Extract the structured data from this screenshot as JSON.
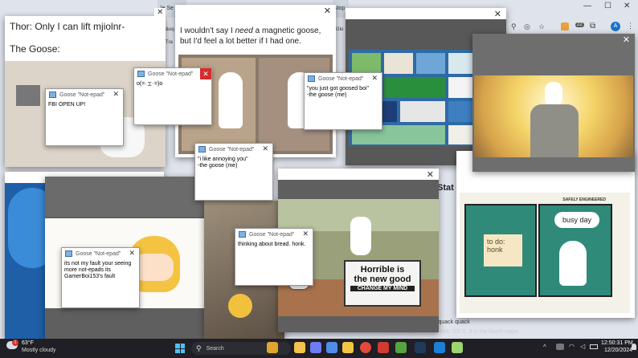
{
  "browser": {
    "tabs": [
      "le Se",
      "stop"
    ],
    "bookmarks": [
      "&oq",
      "Tra",
      "Glo"
    ],
    "profile_initial": "A",
    "ext_badge": "22"
  },
  "meme1": {
    "line1": "Thor: Only I can lift mjiolnr-",
    "line2": "The Goose:"
  },
  "meme2": {
    "text_before": "I wouldn't say I ",
    "text_em": "need",
    "text_after": " a magnetic goose, but I'd feel a lot better if I had one."
  },
  "meme_busy": {
    "header": "SAFELY ENGINEERED",
    "todo": "to do:\nhonk",
    "busy": "busy day"
  },
  "meme_change": {
    "line1": "Horrible is",
    "line2": "the new good",
    "line3": "CHANGE MY MIND"
  },
  "notepads": [
    {
      "title": "Goose \"Not-epad\"",
      "text": "FBI OPEN UP!"
    },
    {
      "title": "Goose \"Not-epad\"",
      "text": "o(=·ェ·=)o"
    },
    {
      "title": "Goose \"Not-epad\"",
      "text": "\"you just got goosed boi\"\n  -the goose (me)"
    },
    {
      "title": "Goose \"Not-epad\"",
      "text": "\"i like annoying you\"\n  -the goose (me)"
    },
    {
      "title": "Goose \"Not-epad\"",
      "text": "its not my fault your seeing more not-epads its GamerBoi153's fault"
    },
    {
      "title": "Goose \"Not-epad\"",
      "text": "thinking about bread. honk."
    }
  ],
  "background_text": {
    "stat": "Stat",
    "quack": "k quack quack",
    "osx": "and in June 2005 for Mac OS X. It is the fourth major",
    "ctical": "ctical"
  },
  "taskbar": {
    "weather_temp": "63°F",
    "weather_desc": "Mostly cloudy",
    "weather_badge": "1",
    "search": "Search",
    "time": "12:50:31 PM",
    "date": "12/20/2024",
    "notif": "99+"
  }
}
